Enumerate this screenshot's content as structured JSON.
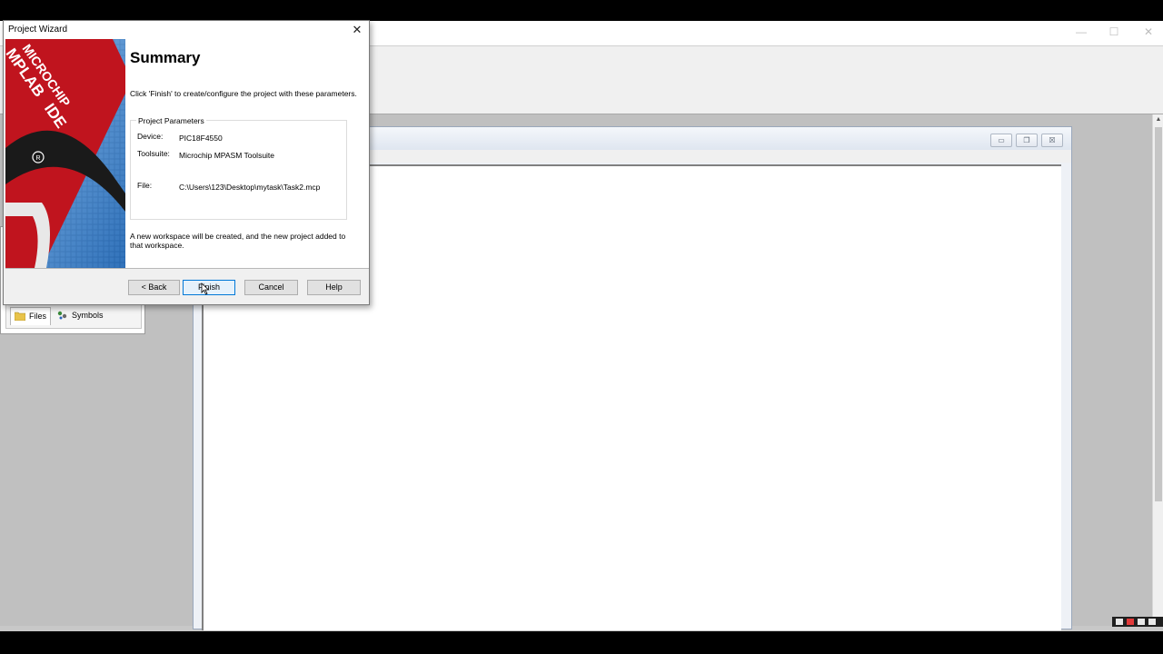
{
  "app": {
    "window_controls": {
      "minimize": "—",
      "maximize": "☐",
      "close": "✕"
    }
  },
  "workspace": {
    "tabs": [
      {
        "label": "Files",
        "icon": "folder-icon"
      },
      {
        "label": "Symbols",
        "icon": "symbols-icon"
      }
    ]
  },
  "child_window": {
    "controls": {
      "minimize": "▭",
      "restore": "❐",
      "close": "☒"
    }
  },
  "dialog": {
    "title": "Project Wizard",
    "close": "✕",
    "heading": "Summary",
    "intro": "Click 'Finish' to create/configure the project with these parameters.",
    "params": {
      "legend": "Project Parameters",
      "device_label": "Device:",
      "device_value": "PIC18F4550",
      "toolsuite_label": "Toolsuite:",
      "toolsuite_value": "Microchip MPASM Toolsuite",
      "file_label": "File:",
      "file_value": "C:\\Users\\123\\Desktop\\mytask\\Task2.mcp"
    },
    "note": "A new workspace will be created, and the new project added to that workspace.",
    "banner": {
      "line1": "MICROCHIP",
      "line2": "MPLAB",
      "line3": "IDE"
    },
    "buttons": {
      "back": "< Back",
      "finish": "Finish",
      "cancel": "Cancel",
      "help": "Help"
    }
  },
  "colors": {
    "accent": "#0078d7",
    "banner_red": "#c0141e",
    "banner_blue": "#1e6fb8"
  }
}
